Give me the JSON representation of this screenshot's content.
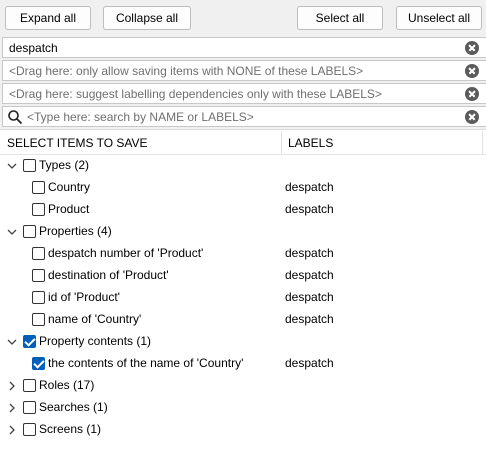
{
  "toolbar": {
    "expand_all": "Expand all",
    "collapse_all": "Collapse all",
    "select_all": "Select all",
    "unselect_all": "Unselect all"
  },
  "fields": {
    "label_filter_value": "despatch",
    "none_labels_hint": "<Drag here: only allow saving items with NONE of these LABELS>",
    "suggest_labels_hint": "<Drag here: suggest labelling dependencies only with these LABELS>",
    "search_hint": "<Type here: search by NAME or LABELS>"
  },
  "columns": {
    "items": "SELECT ITEMS TO SAVE",
    "labels": "LABELS"
  },
  "tree": [
    {
      "label": "Types (2)",
      "expanded": true,
      "checked": false,
      "children": [
        {
          "label": "Country",
          "tag": "despatch",
          "checked": false
        },
        {
          "label": "Product",
          "tag": "despatch",
          "checked": false
        }
      ]
    },
    {
      "label": "Properties (4)",
      "expanded": true,
      "checked": false,
      "children": [
        {
          "label": "despatch number of 'Product'",
          "tag": "despatch",
          "checked": false
        },
        {
          "label": "destination of 'Product'",
          "tag": "despatch",
          "checked": false
        },
        {
          "label": "id of 'Product'",
          "tag": "despatch",
          "checked": false
        },
        {
          "label": "name of 'Country'",
          "tag": "despatch",
          "checked": false
        }
      ]
    },
    {
      "label": "Property contents (1)",
      "expanded": true,
      "checked": true,
      "children": [
        {
          "label": "the contents of the name of 'Country'",
          "tag": "despatch",
          "checked": true
        }
      ]
    },
    {
      "label": "Roles (17)",
      "expanded": false,
      "checked": false,
      "children": []
    },
    {
      "label": "Searches (1)",
      "expanded": false,
      "checked": false,
      "children": []
    },
    {
      "label": "Screens (1)",
      "expanded": false,
      "checked": false,
      "children": []
    }
  ]
}
